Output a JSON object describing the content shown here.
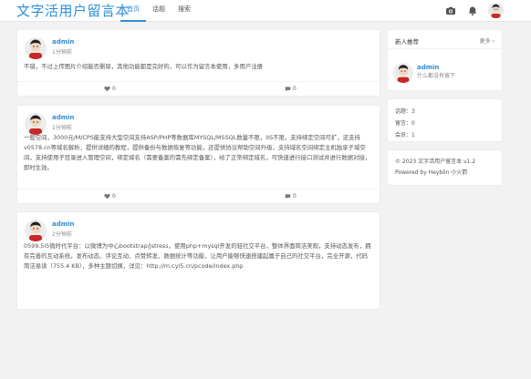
{
  "header": {
    "brand": "文字活用户留言本",
    "nav": [
      "首页",
      "话题",
      "搜索"
    ],
    "icons": [
      "camera-icon",
      "bell-icon"
    ]
  },
  "posts": [
    {
      "name": "admin",
      "time": "1分钟前",
      "body": "不错，不过上传图片介绍能否删除，其他功能都是完好的，可以作为留言本使用，多用户注册",
      "likes": "0",
      "comments": "0"
    },
    {
      "name": "admin",
      "time": "1分钟前",
      "body": "一般空间，3000元/M/CPS能支持大型空间支持ASP/PHP等数据库MYSQL/MSSQL数量不限，IIS不限，支持绑定空间可扩，还支持v0578.cn等域名解析，提供详细的教程，提供备份与数据恢复等功能，还提供协议帮助空间升级，支持域名空间绑定主机独享子域空间，支持使用子目录进入管理空间，绑定域名（需要备案的需先绑定备案），给了正常绑定域名，可快速进行接口测试并进行数据对接，即时生效。",
      "likes": "0",
      "comments": "0"
    },
    {
      "name": "admin",
      "time": "2分钟前",
      "body": "0599.5i5微时代平台：以微博为中心bootstrap/jstress，使用php+mysql开发的轻社交平台，整体界面简洁美观，支持动态发布，拥有完善的互动系统，发布动态、评论互动、点赞转发、数据统计等功能，让用户能够快速搭建起属于自己的社交平台，完全开源，代码简洁易读（755.4 KB），多种主题切换，详见：http://m.cyl5.cn/pcode/index.php",
      "likes": "0",
      "comments": "0"
    }
  ],
  "sidebar": {
    "new_users_title": "新人推荐",
    "more_label": "更多",
    "user_name": "admin",
    "user_desc": "什么都没有留下",
    "stats": [
      "话题：3",
      "留言：0",
      "会员：1"
    ],
    "footer_lines": [
      "© 2023 文字活用户留言本 v1.2",
      "Powered by Heyblin 小火箭"
    ]
  }
}
